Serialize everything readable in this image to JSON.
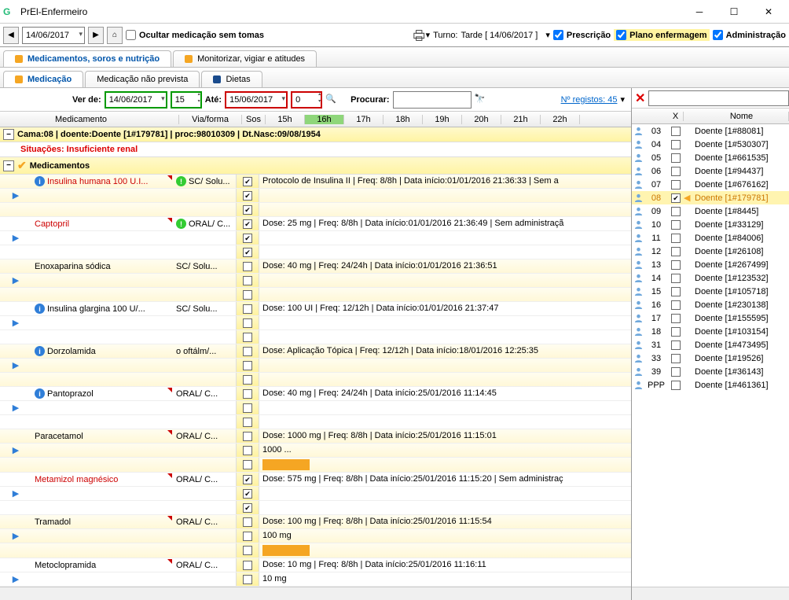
{
  "window": {
    "title": "PrEl-Enfermeiro"
  },
  "toolbar": {
    "date": "14/06/2017",
    "hide_no_doses": "Ocultar medicação sem tomas",
    "turno_label": "Turno:",
    "turno_value": "Tarde [ 14/06/2017 ]",
    "prescricao": "Prescrição",
    "plano": "Plano enfermagem",
    "administracao": "Administração"
  },
  "tabs1": {
    "meds": "Medicamentos, soros e nutrição",
    "monitor": "Monitorizar, vigiar e atitudes"
  },
  "tabs2": {
    "medicacao": "Medicação",
    "naoprevista": "Medicação não prevista",
    "dietas": "Dietas"
  },
  "filter": {
    "verde": "Ver de:",
    "verde_date": "14/06/2017",
    "verde_hour": "15",
    "ate": "Até:",
    "ate_date": "15/06/2017",
    "ate_hour": "0",
    "procurar": "Procurar:",
    "nregistos": "Nº registos: 45"
  },
  "gridheaders": {
    "medicamento": "Medicamento",
    "viaforma": "Via/forma",
    "sos": "Sos",
    "hours": [
      "15h",
      "16h",
      "17h",
      "18h",
      "19h",
      "20h",
      "21h",
      "22h"
    ]
  },
  "patient": {
    "line": "Cama:08 | doente:Doente [1#179781] | proc:98010309 | Dt.Nasc:09/08/1954",
    "situacoes": "Situações: Insuficiente renal",
    "section": "Medicamentos"
  },
  "meds": [
    {
      "name": "Insulina humana 100 U.I...",
      "info": true,
      "warn": true,
      "via": "SC/ Solu...",
      "desc": "Protocolo de Insulina II | Freq: 8/8h | Data início:01/01/2016 21:36:33 | Sem a",
      "red": true,
      "sos3": true,
      "corner": true,
      "expand": true
    },
    {
      "name": "Captopril",
      "warn": true,
      "via": "ORAL/ C...",
      "desc": "Dose: 25 mg | Freq: 8/8h | Data início:01/01/2016 21:36:49 | Sem administraçã",
      "red": true,
      "sos3": true,
      "corner": true,
      "expand": true
    },
    {
      "name": "Enoxaparina sódica",
      "via": "SC/ Solu...",
      "desc": "Dose: 40 mg | Freq: 24/24h | Data início:01/01/2016 21:36:51",
      "expand": true
    },
    {
      "name": "Insulina glargina 100 U/...",
      "info": true,
      "via": "SC/ Solu...",
      "desc": "Dose: 100 UI | Freq: 12/12h | Data início:01/01/2016 21:37:47",
      "expand": true
    },
    {
      "name": "Dorzolamida",
      "info": true,
      "via": "o oftálm/...",
      "desc": "Dose: Aplicação Tópica | Freq: 12/12h | Data início:18/01/2016 12:25:35",
      "expand": true
    },
    {
      "name": "Pantoprazol",
      "info": true,
      "via": "ORAL/ C...",
      "desc": "Dose: 40 mg | Freq: 24/24h | Data início:25/01/2016 11:14:45",
      "corner": true,
      "expand": true
    },
    {
      "name": "Paracetamol",
      "via": "ORAL/ C...",
      "desc": "Dose: 1000 mg | Freq: 8/8h | Data início:25/01/2016 11:15:01",
      "extra": "1000 ...",
      "bar": true,
      "corner": true,
      "expand": true
    },
    {
      "name": "Metamizol magnésico",
      "via": "ORAL/ C...",
      "desc": "Dose: 575 mg | Freq: 8/8h | Data início:25/01/2016 11:15:20 | Sem administraç",
      "red": true,
      "sos3": true,
      "corner": true,
      "expand": true
    },
    {
      "name": "Tramadol",
      "via": "ORAL/ C...",
      "desc": "Dose: 100 mg | Freq: 8/8h | Data início:25/01/2016 11:15:54",
      "extra": "100 mg",
      "bar": true,
      "corner": true,
      "expand": true
    },
    {
      "name": "Metoclopramida",
      "via": "ORAL/ C...",
      "desc": "Dose: 10 mg | Freq: 8/8h | Data início:25/01/2016 11:16:11",
      "extra": "10 mg",
      "corner": true,
      "expand": true
    }
  ],
  "rightheaders": {
    "x": "X",
    "nome": "Nome"
  },
  "patients": [
    {
      "bed": "03",
      "name": "Doente [1#88081]"
    },
    {
      "bed": "04",
      "name": "Doente [1#530307]"
    },
    {
      "bed": "05",
      "name": "Doente [1#661535]"
    },
    {
      "bed": "06",
      "name": "Doente [1#94437]"
    },
    {
      "bed": "07",
      "name": "Doente [1#676162]"
    },
    {
      "bed": "08",
      "name": "Doente [1#179781]",
      "sel": true,
      "checked": true
    },
    {
      "bed": "09",
      "name": "Doente [1#8445]"
    },
    {
      "bed": "10",
      "name": "Doente [1#33129]"
    },
    {
      "bed": "11",
      "name": "Doente [1#84006]"
    },
    {
      "bed": "12",
      "name": "Doente [1#26108]"
    },
    {
      "bed": "13",
      "name": "Doente [1#267499]"
    },
    {
      "bed": "14",
      "name": "Doente [1#123532]"
    },
    {
      "bed": "15",
      "name": "Doente [1#105718]"
    },
    {
      "bed": "16",
      "name": "Doente [1#230138]"
    },
    {
      "bed": "17",
      "name": "Doente [1#155595]"
    },
    {
      "bed": "18",
      "name": "Doente [1#103154]"
    },
    {
      "bed": "31",
      "name": "Doente [1#473495]"
    },
    {
      "bed": "33",
      "name": "Doente [1#19526]"
    },
    {
      "bed": "39",
      "name": "Doente [1#36143]"
    },
    {
      "bed": "PPP",
      "name": "Doente [1#461361]"
    }
  ]
}
